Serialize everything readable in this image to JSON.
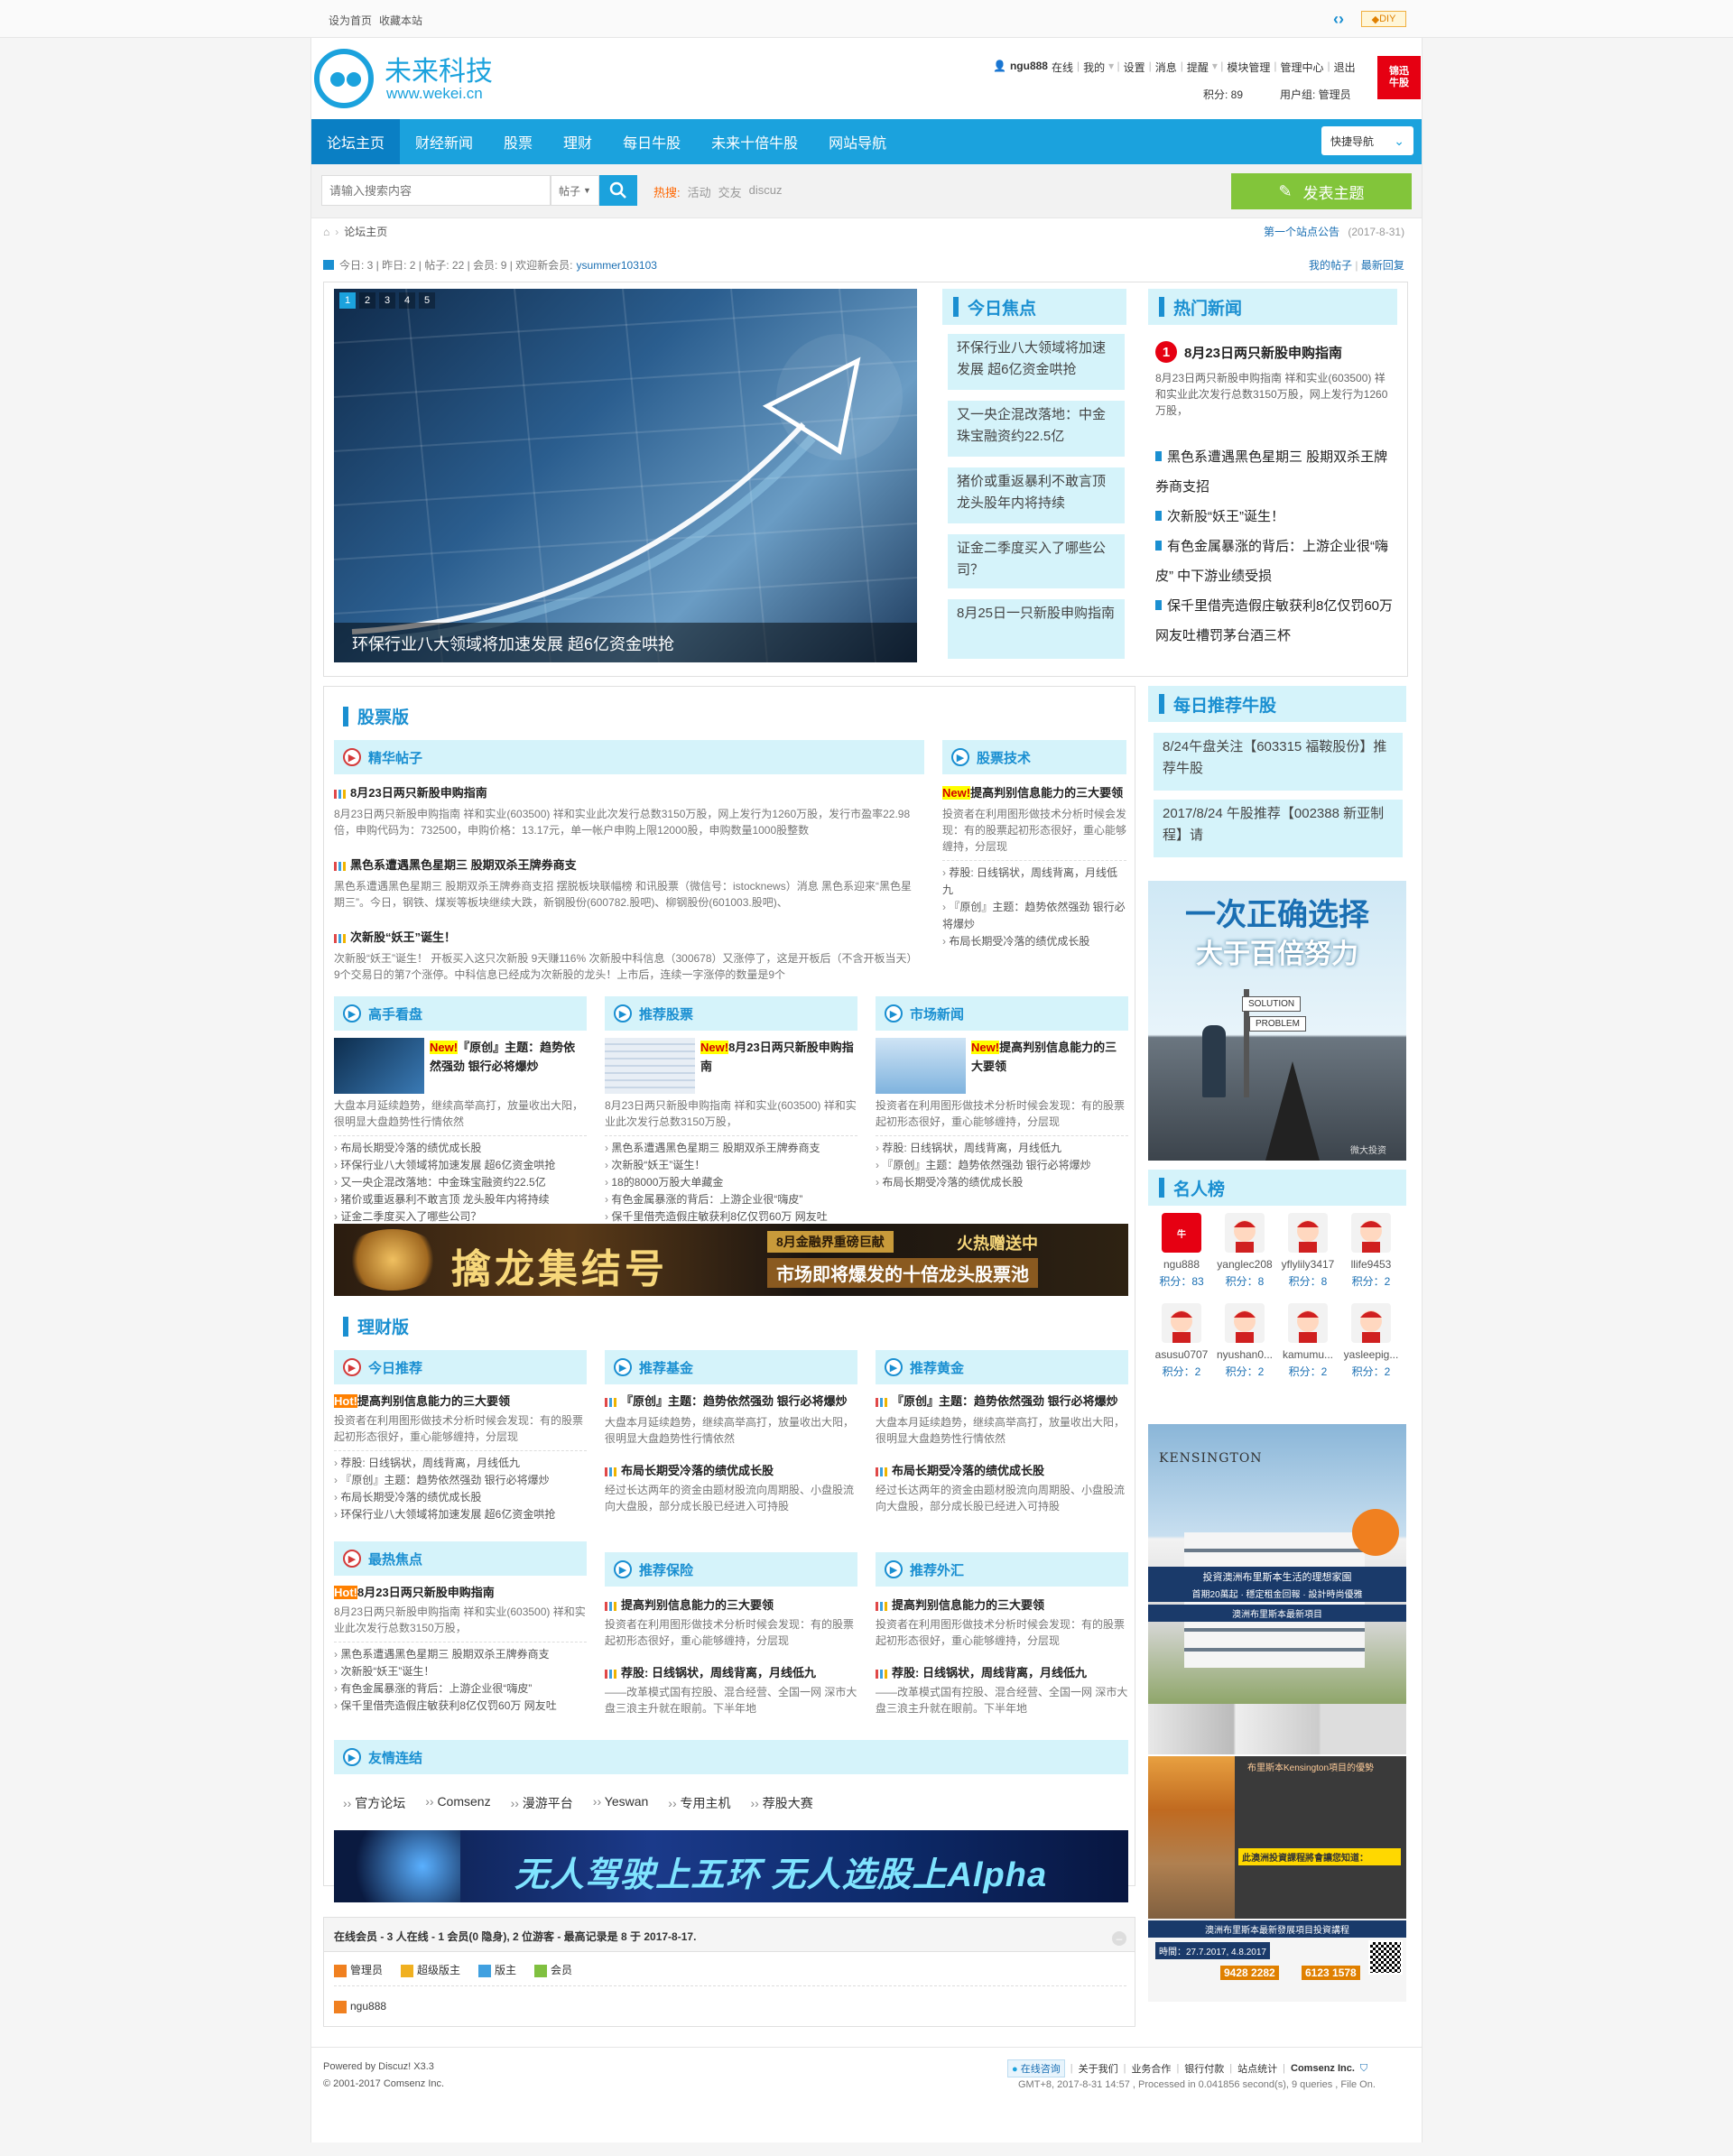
{
  "topbar": {
    "set_home": "设为首页",
    "favorite": "收藏本站",
    "diy": "DIY"
  },
  "logo": {
    "name": "未来科技",
    "url": "www.wekei.cn"
  },
  "user": {
    "name": "ngu888",
    "status": "在线",
    "menus": [
      "我的",
      "设置",
      "消息",
      "提醒",
      "模块管理",
      "管理中心",
      "退出"
    ],
    "points": "积分: 89",
    "group": "用户组: 管理员",
    "badge": "锦迅 牛股"
  },
  "nav": {
    "items": [
      "论坛主页",
      "财经新闻",
      "股票",
      "理财",
      "每日牛股",
      "未来十倍牛股",
      "网站导航"
    ],
    "quick_nav": "快捷导航"
  },
  "search": {
    "placeholder": "请输入搜索内容",
    "type": "帖子",
    "hot_label": "热搜:",
    "hot_words": [
      "活动",
      "交友",
      "discuz"
    ],
    "post_button": "发表主题"
  },
  "breadcrumb": {
    "current": "论坛主页",
    "notice": "第一个站点公告",
    "notice_date": "(2017-8-31)"
  },
  "stats": {
    "text": "今日: 3 | 昨日: 2 | 帖子: 22 | 会员: 9 | 欢迎新会员:",
    "newest": "ysummer103103",
    "my_posts": "我的帖子",
    "latest_reply": "最新回复"
  },
  "slider": {
    "caption": "环保行业八大领域将加速发展 超6亿资金哄抢",
    "pages": [
      "1",
      "2",
      "3",
      "4",
      "5"
    ]
  },
  "focus": {
    "title": "今日焦点",
    "items": [
      "环保行业八大领域将加速发展 超6亿资金哄抢",
      "又一央企混改落地：中金珠宝融资约22.5亿",
      "猪价或重返暴利不敢言顶 龙头股年内将持续",
      "证金二季度买入了哪些公司？",
      "8月25日一只新股申购指南"
    ]
  },
  "hotnews": {
    "title": "热门新闻",
    "top_num": "1",
    "top_title": "8月23日两只新股申购指南",
    "top_desc": "8月23日两只新股申购指南 祥和实业(603500) 祥和实业此次发行总数3150万股，网上发行为1260万股，",
    "items": [
      "黑色系遭遇黑色星期三 股期双杀王牌券商支招",
      "次新股“妖王”诞生！",
      "有色金属暴涨的背后：上游企业很“嗨皮” 中下游业绩受损",
      "保千里借壳造假庄敏获利8亿仅罚60万 网友吐槽罚茅台酒三杯"
    ]
  },
  "stock": {
    "title": "股票版",
    "essence": {
      "title": "精华帖子",
      "posts": [
        {
          "title": "8月23日两只新股申购指南",
          "desc": "8月23日两只新股申购指南 祥和实业(603500) 祥和实业此次发行总数3150万股，网上发行为1260万股，发行市盈率22.98倍，申购代码为：732500，申购价格：13.17元，单一帐户申购上限12000股，申购数量1000股整数"
        },
        {
          "title": "黑色系遭遇黑色星期三 股期双杀王牌券商支",
          "desc": "黑色系遭遇黑色星期三 股期双杀王牌券商支招 摆脱板块联幅榜 和讯股票（微信号：istocknews）消息 黑色系迎来“黑色星期三”。今日，钢铁、煤炭等板块继续大跌，新钢股份(600782.股吧)、柳钢股份(601003.股吧)、"
        },
        {
          "title": "次新股“妖王”诞生！",
          "desc": "次新股“妖王”诞生！ 开板买入这只次新股 9天赚116% 次新股中科信息（300678）又涨停了，这是开板后（不含开板当天）9个交易日的第7个涨停。中科信息已经成为次新股的龙头！上市后，连续一字涨停的数量是9个"
        }
      ]
    },
    "tech": {
      "title": "股票技术",
      "new_label": "New!",
      "lead": "提高判别信息能力的三大要领",
      "desc": "投资者在利用图形做技术分析时候会发现：有的股票起初形态很好，重心能够缠持，分层现",
      "items": [
        "荐股: 日线锅状，周线背离，月线低九",
        "『原创』主题：趋势依然强劲 银行必将爆炒",
        "布局长期受冷落的绩优成长股"
      ]
    },
    "boxes": [
      {
        "title": "高手看盘",
        "new_label": "New!",
        "lead": "『原创』主题：趋势依然强劲 银行必将爆炒",
        "desc": "大盘本月延续趋势，继续高举高打，放量收出大阳，很明显大盘趋势性行情依然",
        "items": [
          "布局长期受冷落的绩优成长股",
          "环保行业八大领域将加速发展 超6亿资金哄抢",
          "又一央企混改落地：中金珠宝融资约22.5亿",
          "猪价或重返暴利不敢言顶 龙头股年内将持续",
          "证金二季度买入了哪些公司？"
        ]
      },
      {
        "title": "推荐股票",
        "new_label": "New!",
        "lead": "8月23日两只新股申购指南",
        "desc": "8月23日两只新股申购指南 祥和实业(603500) 祥和实业此次发行总数3150万股，",
        "items": [
          "黑色系遭遇黑色星期三 股期双杀王牌券商支",
          "次新股“妖王”诞生！",
          "18的8000万股大单藏金",
          "有色金属暴涨的背后：上游企业很“嗨皮”",
          "保千里借壳造假庄敏获利8亿仅罚60万 网友吐"
        ]
      },
      {
        "title": "市场新闻",
        "new_label": "New!",
        "lead": "提高判别信息能力的三大要领",
        "desc": "投资者在利用图形做技术分析时候会发现：有的股票起初形态很好，重心能够缠持，分层现",
        "items": [
          "荐股: 日线锅状，周线背离，月线低九",
          "『原创』主题：趋势依然强劲 银行必将爆炒",
          "布局长期受冷落的绩优成长股"
        ]
      }
    ],
    "banner": {
      "text": "擒龙集结号",
      "tag": "8月金融界重磅巨献",
      "sub": "火热赠送中",
      "sub2": "市场即将爆发的十倍龙头股票池"
    }
  },
  "finance": {
    "title": "理财版",
    "boxes": [
      {
        "title": "今日推荐",
        "label": "Hot!",
        "lead": "提高判别信息能力的三大要领",
        "desc": "投资者在利用图形做技术分析时候会发现：有的股票起初形态很好，重心能够缠持，分层现",
        "items": [
          "荐股: 日线锅状，周线背离，月线低九",
          "『原创』主题：趋势依然强劲 银行必将爆炒",
          "布局长期受冷落的绩优成长股",
          "环保行业八大领域将加速发展 超6亿资金哄抢"
        ]
      },
      {
        "title": "推荐基金",
        "p1": "『原创』主题：趋势依然强劲 银行必将爆炒",
        "d1": "大盘本月延续趋势，继续高举高打，放量收出大阳，很明显大盘趋势性行情依然",
        "p2": "布局长期受冷落的绩优成长股",
        "d2": "经过长达两年的资金由题材股流向周期股、小盘股流向大盘股，部分成长股已经进入可持股"
      },
      {
        "title": "推荐黄金",
        "p1": "『原创』主题：趋势依然强劲 银行必将爆炒",
        "d1": "大盘本月延续趋势，继续高举高打，放量收出大阳，很明显大盘趋势性行情依然",
        "p2": "布局长期受冷落的绩优成长股",
        "d2": "经过长达两年的资金由题材股流向周期股、小盘股流向大盘股，部分成长股已经进入可持股"
      },
      {
        "title": "最热焦点",
        "label": "Hot!",
        "lead": "8月23日两只新股申购指南",
        "desc": "8月23日两只新股申购指南 祥和实业(603500) 祥和实业此次发行总数3150万股，",
        "items": [
          "黑色系遭遇黑色星期三 股期双杀王牌券商支",
          "次新股“妖王”诞生！",
          "有色金属暴涨的背后：上游企业很“嗨皮”",
          "保千里借壳造假庄敏获利8亿仅罚60万 网友吐"
        ]
      },
      {
        "title": "推荐保险",
        "p1": "提高判别信息能力的三大要领",
        "d1": "投资者在利用图形做技术分析时候会发现：有的股票起初形态很好，重心能够缠持，分层现",
        "p2": "荐股: 日线锅状，周线背离，月线低九",
        "d2": "——改革模式国有控股、混合经营、全国一网 深市大盘三浪主升就在眼前。下半年地"
      },
      {
        "title": "推荐外汇",
        "p1": "提高判别信息能力的三大要领",
        "d1": "投资者在利用图形做技术分析时候会发现：有的股票起初形态很好，重心能够缠持，分层现",
        "p2": "荐股: 日线锅状，周线背离，月线低九",
        "d2": "——改革模式国有控股、混合经营、全国一网 深市大盘三浪主升就在眼前。下半年地"
      }
    ]
  },
  "links": {
    "title": "友情连结",
    "items": [
      "官方论坛",
      "Comsenz",
      "漫游平台",
      "Yeswan",
      "专用主机",
      "荐股大赛"
    ]
  },
  "alpha_banner": {
    "text": "无人驾驶上五环 无人选股上Alpha"
  },
  "online": {
    "text": "在线会员 - 3 人在线 - 1 会员(0 隐身), 2 位游客 - 最高记录是 8 于 2017-8-17.",
    "legend": [
      "管理员",
      "超级版主",
      "版主",
      "会员"
    ],
    "member": "ngu888"
  },
  "sidebar": {
    "daily": {
      "title": "每日推荐牛股",
      "items": [
        "8/24午盘关注【603315 福鞍股份】推荐牛股",
        "2017/8/24 午股推荐【002388 新亚制程】请"
      ]
    },
    "ad1": {
      "line1": "一次正确选择",
      "line2": "大于百倍努力",
      "sign1": "SOLUTION",
      "sign2": "PROBLEM",
      "credit": "微大投资"
    },
    "celeb": {
      "title": "名人榜",
      "users": [
        {
          "name": "ngu888",
          "points": "积分：83"
        },
        {
          "name": "yanglec208",
          "points": "积分：8"
        },
        {
          "name": "yflylily3417",
          "points": "积分：8"
        },
        {
          "name": "llife9453",
          "points": "积分：2"
        },
        {
          "name": "asusu0707",
          "points": "积分：2"
        },
        {
          "name": "nyushan0...",
          "points": "积分：2"
        },
        {
          "name": "kamumu...",
          "points": "积分：2"
        },
        {
          "name": "yasleepig...",
          "points": "积分：2"
        }
      ]
    },
    "ad2": {
      "brand": "KENSINGTON",
      "headline": "投資澳洲布里斯本生活的理想家園",
      "sub": "首期20萬起 · 穩定租金回報 · 設計時尚優雅",
      "project": "澳洲布里斯本最新項目",
      "course_title": "布里斯本Kensington項目的優勢",
      "table_head": "此澳洲投資課程將會讓您知道：",
      "date": "時間：27.7.2017, 4.8.2017",
      "seminar": "澳洲布里斯本最新發展項目投資講程",
      "phone1": "9428 2282",
      "phone2": "6123 1578"
    }
  },
  "footer": {
    "powered": "Powered by Discuz! X3.3",
    "copyright": "© 2001-2017 Comsenz Inc.",
    "links": [
      "在线咨询",
      "关于我们",
      "业务合作",
      "银行付款",
      "站点统计",
      "Comsenz Inc."
    ],
    "info": "GMT+8, 2017-8-31 14:57 , Processed in 0.041856 second(s), 9 queries , File On."
  },
  "colors": {
    "primary": "#1ba2dd",
    "section_bg": "#d5f3fa",
    "accent_green": "#82c53a",
    "accent_red": "#d43a3a"
  }
}
